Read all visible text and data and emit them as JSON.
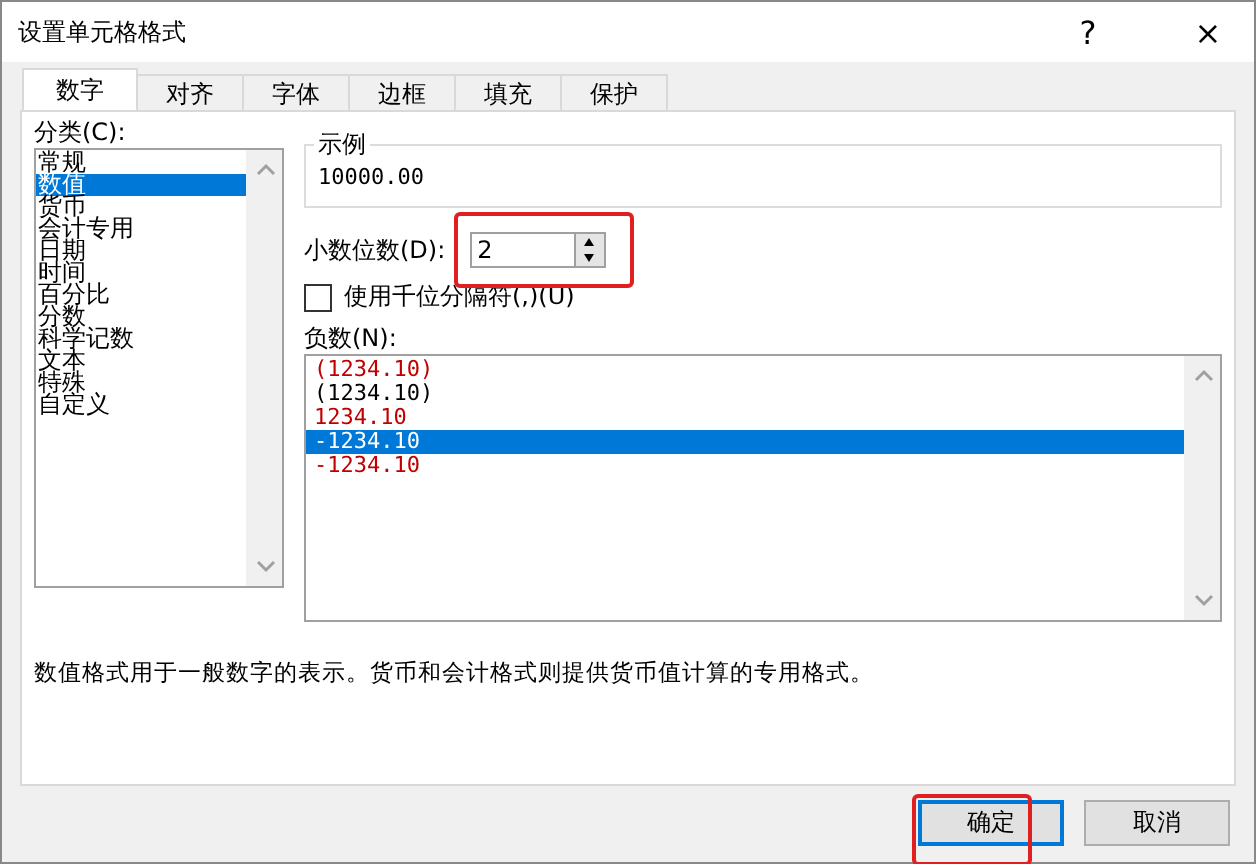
{
  "window": {
    "title": "设置单元格格式",
    "help": "?",
    "close": "×"
  },
  "tabs": [
    {
      "label": "数字",
      "selected": true
    },
    {
      "label": "对齐",
      "selected": false
    },
    {
      "label": "字体",
      "selected": false
    },
    {
      "label": "边框",
      "selected": false
    },
    {
      "label": "填充",
      "selected": false
    },
    {
      "label": "保护",
      "selected": false
    }
  ],
  "category": {
    "label": "分类(C):",
    "items": [
      {
        "label": "常规",
        "selected": false
      },
      {
        "label": "数值",
        "selected": true
      },
      {
        "label": "货币",
        "selected": false
      },
      {
        "label": "会计专用",
        "selected": false
      },
      {
        "label": "日期",
        "selected": false
      },
      {
        "label": "时间",
        "selected": false
      },
      {
        "label": "百分比",
        "selected": false
      },
      {
        "label": "分数",
        "selected": false
      },
      {
        "label": "科学记数",
        "selected": false
      },
      {
        "label": "文本",
        "selected": false
      },
      {
        "label": "特殊",
        "selected": false
      },
      {
        "label": "自定义",
        "selected": false
      }
    ]
  },
  "sample": {
    "label": "示例",
    "value": "10000.00"
  },
  "decimal_places": {
    "label": "小数位数(D):",
    "value": "2",
    "highlighted": true
  },
  "thousands_separator": {
    "label": "使用千位分隔符(,)(U)",
    "checked": false
  },
  "negative_numbers": {
    "label": "负数(N):",
    "items": [
      {
        "label": "(1234.10)",
        "red": true,
        "selected": false
      },
      {
        "label": "(1234.10)",
        "red": false,
        "selected": false
      },
      {
        "label": "1234.10",
        "red": true,
        "selected": false
      },
      {
        "label": "-1234.10",
        "red": false,
        "selected": true
      },
      {
        "label": "-1234.10",
        "red": true,
        "selected": false
      }
    ]
  },
  "description": "数值格式用于一般数字的表示。货币和会计格式则提供货币值计算的专用格式。",
  "buttons": [
    {
      "label": "确定",
      "default": true,
      "highlighted": true
    },
    {
      "label": "取消",
      "default": false,
      "highlighted": false
    }
  ]
}
